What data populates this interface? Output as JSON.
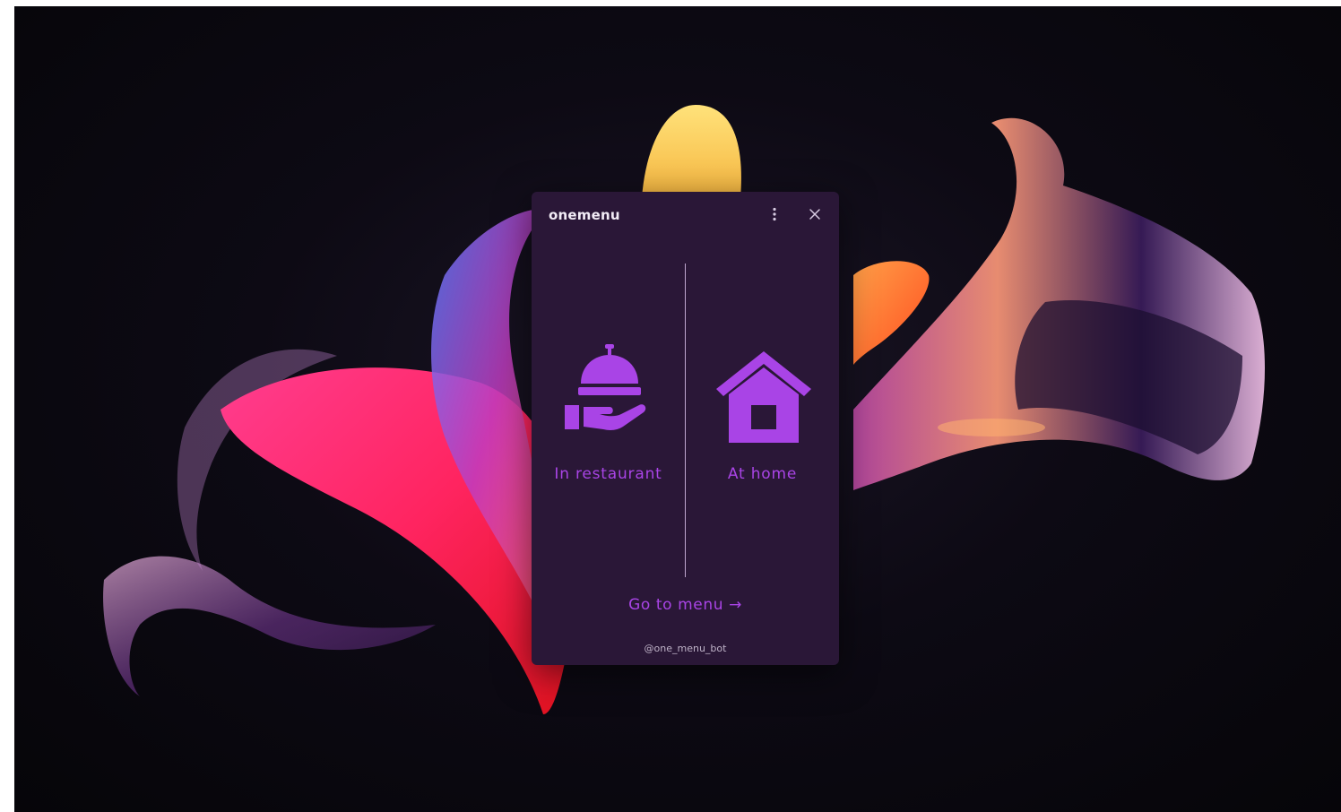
{
  "colors": {
    "window_background": "#2a1737",
    "accent": "#a944e6",
    "divider": "#bfa6cf",
    "title_text": "#f2ecf6",
    "footer_text": "#bfb3c8"
  },
  "window": {
    "title": "onemenu",
    "more_icon": "more-vertical-icon",
    "close_icon": "close-icon"
  },
  "options": [
    {
      "label": "In restaurant",
      "icon": "serving-cloche-icon"
    },
    {
      "label": "At home",
      "icon": "house-icon"
    }
  ],
  "go_link": {
    "label": "Go to menu →"
  },
  "footer": {
    "handle": "@one_menu_bot"
  }
}
